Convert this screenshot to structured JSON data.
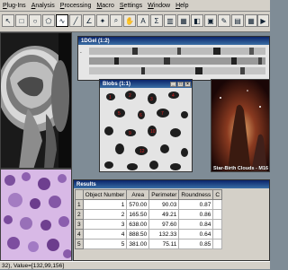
{
  "menu": [
    "Plug-Ins",
    "Analysis",
    "Processing",
    "Macro",
    "Settings",
    "Window",
    "Help"
  ],
  "toolbar": {
    "icons": [
      "arrow-icon",
      "rect-select-icon",
      "oval-select-icon",
      "polygon-icon",
      "freehand-icon",
      "line-icon",
      "angle-icon",
      "wand-icon",
      "zoom-icon",
      "hand-icon",
      "text-icon",
      "stats-icon",
      "histogram-icon",
      "profile-icon",
      "color-picker-icon",
      "fill-icon",
      "brush-icon",
      "histogram-chart-icon",
      "table-icon",
      "play-icon",
      "help-icon"
    ]
  },
  "gel_window": {
    "title": "1DGel (1:2)"
  },
  "blobs_window": {
    "title": "Blobs (1:1)"
  },
  "nebula": {
    "caption": "Star-Birth Clouds - M16"
  },
  "results": {
    "title": "Results",
    "columns": [
      "Object Number",
      "Area",
      "Perimeter",
      "Roundness",
      "C"
    ],
    "rows": [
      {
        "n": "1",
        "obj": "1",
        "area": "570.00",
        "perim": "90.03",
        "round": "0.87"
      },
      {
        "n": "2",
        "obj": "2",
        "area": "165.50",
        "perim": "49.21",
        "round": "0.86"
      },
      {
        "n": "3",
        "obj": "3",
        "area": "638.00",
        "perim": "97.60",
        "round": "0.84"
      },
      {
        "n": "4",
        "obj": "4",
        "area": "888.50",
        "perim": "132.33",
        "round": "0.64"
      },
      {
        "n": "5",
        "obj": "5",
        "area": "381.00",
        "perim": "75.11",
        "round": "0.85"
      }
    ]
  },
  "status": {
    "text": "32), Value=[132,99,156]"
  }
}
